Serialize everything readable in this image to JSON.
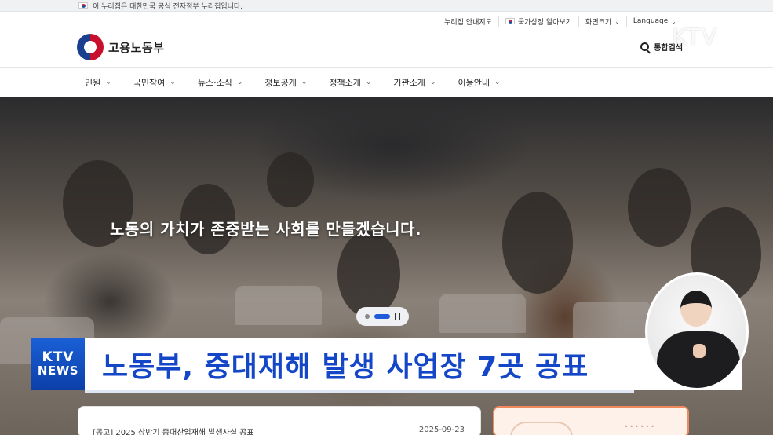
{
  "gov_banner": {
    "text": "이 누리집은 대한민국 공식 전자정부 누리집입니다."
  },
  "utility": {
    "sitemap": "누리집 안내지도",
    "national_symbol": "국가상징 알아보기",
    "screen_size": "화면크기",
    "language": "Language"
  },
  "header": {
    "logo_text": "고용노동부",
    "search_label": "통합검색"
  },
  "nav": {
    "items": [
      {
        "label": "민원"
      },
      {
        "label": "국민참여"
      },
      {
        "label": "뉴스·소식"
      },
      {
        "label": "정보공개"
      },
      {
        "label": "정책소개"
      },
      {
        "label": "기관소개"
      },
      {
        "label": "이용안내"
      }
    ]
  },
  "hero": {
    "slogan": "노동의 가치가 존중받는 사회를 만들겠습니다."
  },
  "broadcast": {
    "watermark": "KTV",
    "logo_line1": "KTV",
    "logo_line2": "NEWS",
    "headline": "노동부, 중대재해 발생 사업장 7곳 공표"
  },
  "notice": {
    "title": "[공고] 2025 상반기 중대산업재해 발생사실 공표",
    "date": "2025-09-23"
  },
  "colors": {
    "headline": "#1446c8",
    "ktv_blue": "#1a5fd6",
    "slider_active": "#1f5bd8",
    "promo_border": "#f08a5d"
  }
}
